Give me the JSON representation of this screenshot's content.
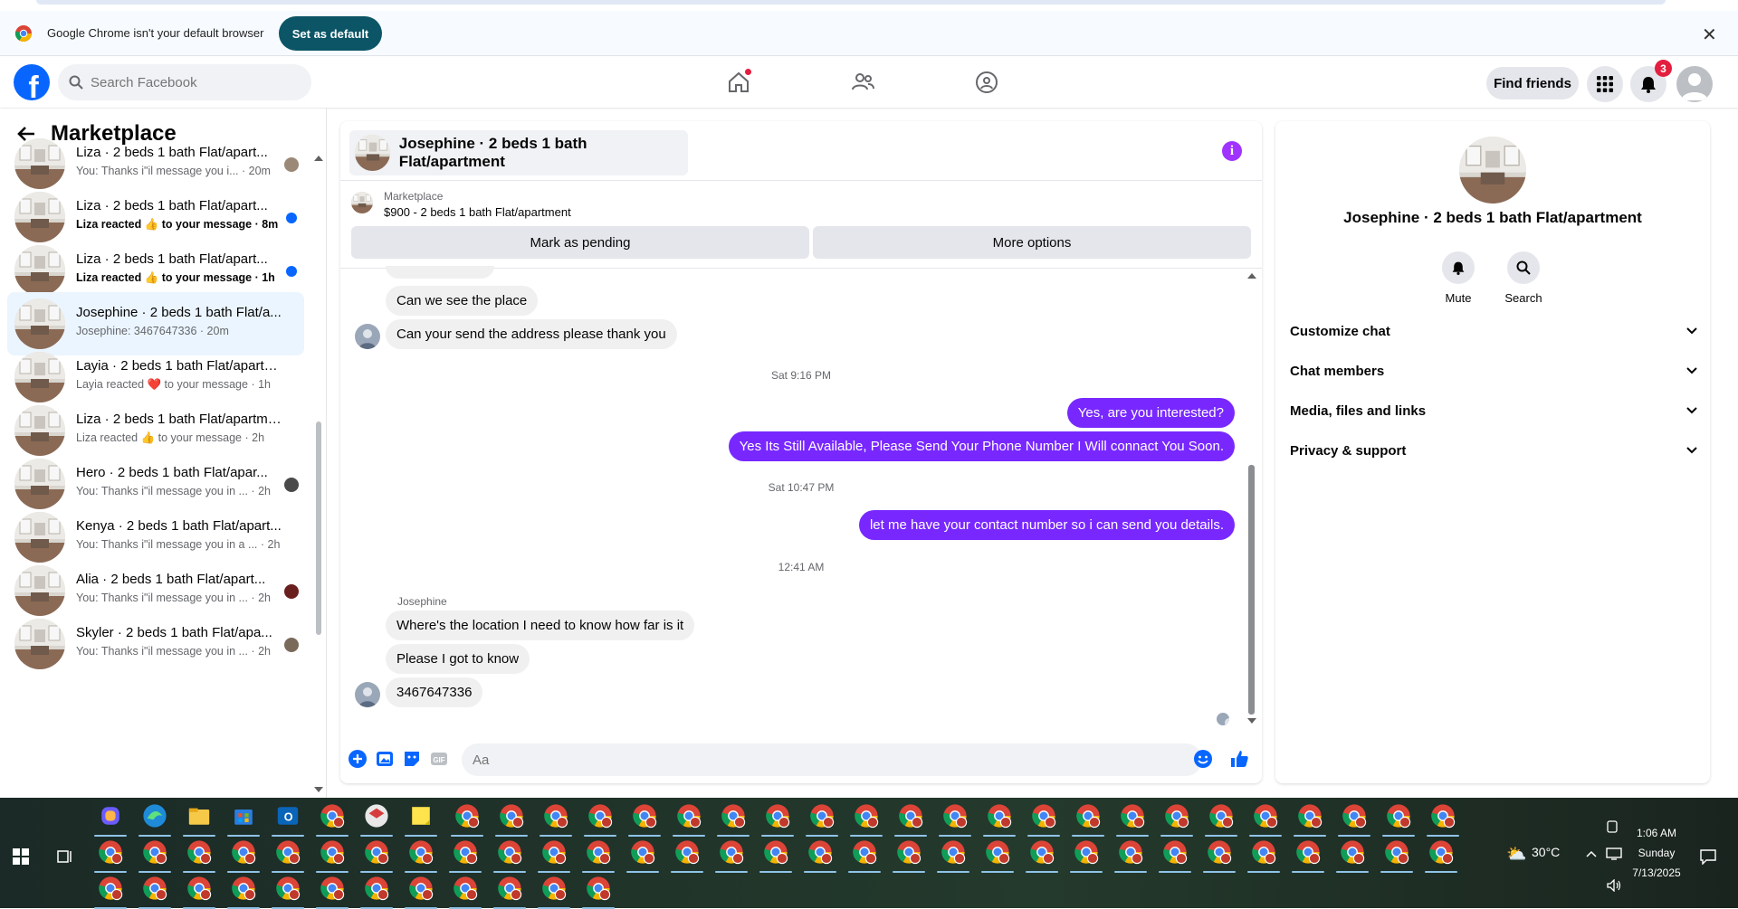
{
  "infobar": {
    "message": "Google Chrome isn't your default browser",
    "set_default": "Set as default",
    "close": "✕"
  },
  "header": {
    "search_placeholder": "Search Facebook",
    "find_friends": "Find friends",
    "notifications_count": "3"
  },
  "sidebar": {
    "title": "Marketplace",
    "conversations": [
      {
        "title": "Liza · 2 beds 1 bath Flat/apart...",
        "subtitle": "You: Thanks i\"il message you i... · 20m",
        "unread": false
      },
      {
        "title": "Liza · 2 beds 1 bath Flat/apart...",
        "subtitle": "Liza reacted 👍 to your message · 8m",
        "unread": true
      },
      {
        "title": "Liza · 2 beds 1 bath Flat/apart...",
        "subtitle": "Liza reacted 👍 to your message · 1h",
        "unread": true
      },
      {
        "title": "Josephine · 2 beds 1 bath Flat/a...",
        "subtitle": "Josephine: 3467647336 · 20m",
        "unread": false
      },
      {
        "title": "Layia · 2 beds 1 bath Flat/apartm...",
        "subtitle": "Layia reacted ❤️ to your message · 1h",
        "unread": false
      },
      {
        "title": "Liza · 2 beds 1 bath Flat/apartme...",
        "subtitle": "Liza reacted 👍 to your message · 2h",
        "unread": false
      },
      {
        "title": "Hero · 2 beds 1 bath Flat/apar...",
        "subtitle": "You: Thanks i\"il message you in ... · 2h",
        "unread": false
      },
      {
        "title": "Kenya · 2 beds 1 bath Flat/apart...",
        "subtitle": "You: Thanks i\"il message you in a ... · 2h",
        "unread": false
      },
      {
        "title": "Alia · 2 beds 1 bath Flat/apart...",
        "subtitle": "You: Thanks i\"il message you in ... · 2h",
        "unread": false
      },
      {
        "title": "Skyler · 2 beds 1 bath Flat/apa...",
        "subtitle": "You: Thanks i\"il message you in ... · 2h",
        "unread": false
      }
    ]
  },
  "chat": {
    "title": "Josephine · 2 beds 1 bath Flat/apartment",
    "marketplace_label": "Marketplace",
    "listing": "$900 - 2 beds 1 bath Flat/apartment",
    "mark_pending": "Mark as pending",
    "more_options": "More options",
    "messages": [
      {
        "dir": "in",
        "text": "Can we see the place"
      },
      {
        "dir": "in",
        "text": "Can your send the address please thank you"
      },
      {
        "stamp": "Sat 9:16 PM"
      },
      {
        "dir": "out",
        "text": "Yes, are you interested?"
      },
      {
        "dir": "out",
        "text": "Yes Its Still Available, Please Send Your Phone Number I Will connact You Soon."
      },
      {
        "stamp": "Sat 10:47 PM"
      },
      {
        "dir": "out",
        "text": "let me have your contact number so i can send you details."
      },
      {
        "stamp": "12:41 AM"
      },
      {
        "sender": "Josephine"
      },
      {
        "dir": "in",
        "text": "Where's the location I need to know how far is it"
      },
      {
        "dir": "in",
        "text": "Please I got to know"
      },
      {
        "dir": "in",
        "text": "3467647336"
      }
    ],
    "composer_placeholder": "Aa"
  },
  "details": {
    "title": "Josephine · 2 beds 1 bath Flat/apartment",
    "mute": "Mute",
    "search": "Search",
    "sections": [
      "Customize chat",
      "Chat members",
      "Media, files and links",
      "Privacy & support"
    ]
  },
  "taskbar": {
    "weather": "30°C",
    "time": "1:06 AM",
    "day": "Sunday",
    "date": "7/13/2025"
  },
  "colors": {
    "accent": "#0866ff",
    "outgoing_bubble": "#7828ff",
    "info_purple": "#a033ff"
  }
}
